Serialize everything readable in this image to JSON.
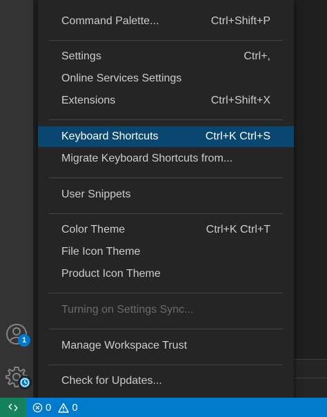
{
  "menu": {
    "items": [
      {
        "label": "Command Palette...",
        "shortcut": "Ctrl+Shift+P"
      },
      {
        "label": "Settings",
        "shortcut": "Ctrl+,"
      },
      {
        "label": "Online Services Settings",
        "shortcut": ""
      },
      {
        "label": "Extensions",
        "shortcut": "Ctrl+Shift+X"
      },
      {
        "label": "Keyboard Shortcuts",
        "shortcut": "Ctrl+K Ctrl+S"
      },
      {
        "label": "Migrate Keyboard Shortcuts from...",
        "shortcut": ""
      },
      {
        "label": "User Snippets",
        "shortcut": ""
      },
      {
        "label": "Color Theme",
        "shortcut": "Ctrl+K Ctrl+T"
      },
      {
        "label": "File Icon Theme",
        "shortcut": ""
      },
      {
        "label": "Product Icon Theme",
        "shortcut": ""
      },
      {
        "label": "Turning on Settings Sync...",
        "shortcut": ""
      },
      {
        "label": "Manage Workspace Trust",
        "shortcut": ""
      },
      {
        "label": "Check for Updates...",
        "shortcut": ""
      }
    ]
  },
  "activity_bar": {
    "accounts_icon": "account-icon",
    "accounts_badge": "1",
    "manage_icon": "gear-icon",
    "manage_badge_icon": "clock-icon"
  },
  "status_bar": {
    "remote_icon": "remote-icon",
    "errors_icon": "error-icon",
    "errors_count": "0",
    "warnings_icon": "warning-icon",
    "warnings_count": "0"
  },
  "colors": {
    "menu_background": "#252526",
    "menu_selection": "#094771",
    "status_bar": "#007acc",
    "remote_indicator": "#16825d",
    "badge": "#007acc"
  }
}
